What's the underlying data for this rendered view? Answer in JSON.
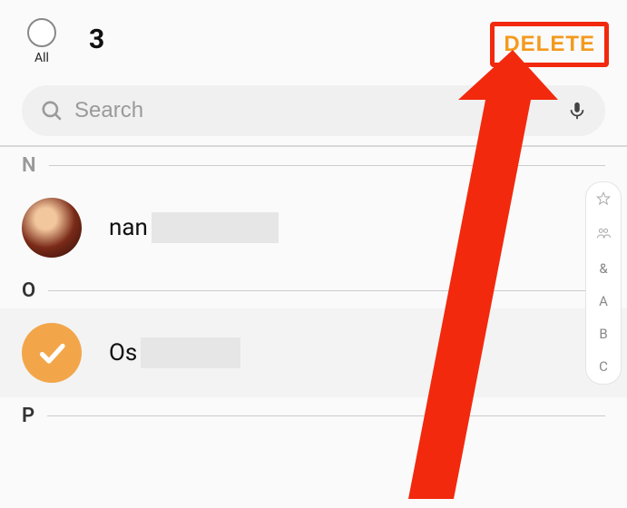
{
  "header": {
    "all_label": "All",
    "selected_count": "3",
    "delete_label": "DELETE"
  },
  "search": {
    "placeholder": "Search"
  },
  "sections": {
    "n_letter": "N",
    "o_letter": "O",
    "p_letter": "P",
    "contact_n_name": "nan",
    "contact_o_name": "Os"
  },
  "index": {
    "amp": "&",
    "a": "A",
    "b": "B",
    "c": "C"
  },
  "colors": {
    "accent": "#f39a1f",
    "highlight_border": "#f2290d"
  }
}
